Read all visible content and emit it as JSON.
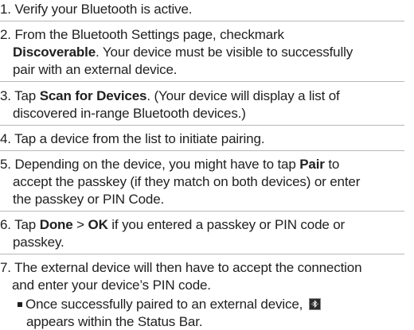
{
  "steps": [
    {
      "lines": [
        {
          "parts": [
            {
              "t": "1. Verify your Bluetooth is active."
            }
          ]
        }
      ]
    },
    {
      "lines": [
        {
          "parts": [
            {
              "t": "2. From the Bluetooth Settings page, checkmark"
            }
          ]
        },
        {
          "parts": [
            {
              "t": "Discoverable",
              "b": true
            },
            {
              "t": ". Your device must be visible to successfully"
            }
          ]
        },
        {
          "parts": [
            {
              "t": "pair with an external device."
            }
          ]
        }
      ]
    },
    {
      "lines": [
        {
          "parts": [
            {
              "t": "3. Tap "
            },
            {
              "t": "Scan for Devices",
              "b": true
            },
            {
              "t": ". (Your device will display a list of"
            }
          ]
        },
        {
          "parts": [
            {
              "t": "discovered in-range Bluetooth devices.)"
            }
          ]
        }
      ]
    },
    {
      "lines": [
        {
          "parts": [
            {
              "t": "4. Tap a device from the list to initiate pairing."
            }
          ]
        }
      ]
    },
    {
      "lines": [
        {
          "parts": [
            {
              "t": "5. Depending on the device, you might have to tap "
            },
            {
              "t": "Pair",
              "b": true
            },
            {
              "t": " to"
            }
          ]
        },
        {
          "parts": [
            {
              "t": "accept the passkey (if they match on both devices) or enter"
            }
          ]
        },
        {
          "parts": [
            {
              "t": "the passkey or PIN Code."
            }
          ]
        }
      ]
    },
    {
      "lines": [
        {
          "parts": [
            {
              "t": "6. Tap "
            },
            {
              "t": "Done",
              "b": true
            },
            {
              "t": " > "
            },
            {
              "t": "OK",
              "b": true
            },
            {
              "t": " if you entered a passkey or PIN code or"
            }
          ]
        },
        {
          "parts": [
            {
              "t": "passkey."
            }
          ]
        }
      ]
    },
    {
      "lines": [
        {
          "parts": [
            {
              "t": "7. The external device will then have to accept the connection"
            }
          ]
        },
        {
          "parts": [
            {
              "t": "and enter your device’s PIN code."
            }
          ]
        }
      ]
    }
  ],
  "bullet": {
    "lines": [
      {
        "parts": [
          {
            "t": "Once successfully paired to an external device, "
          }
        ],
        "icon": "bluetooth-connected-status-icon"
      },
      {
        "parts": [
          {
            "t": "appears within the Status Bar."
          }
        ]
      }
    ]
  }
}
